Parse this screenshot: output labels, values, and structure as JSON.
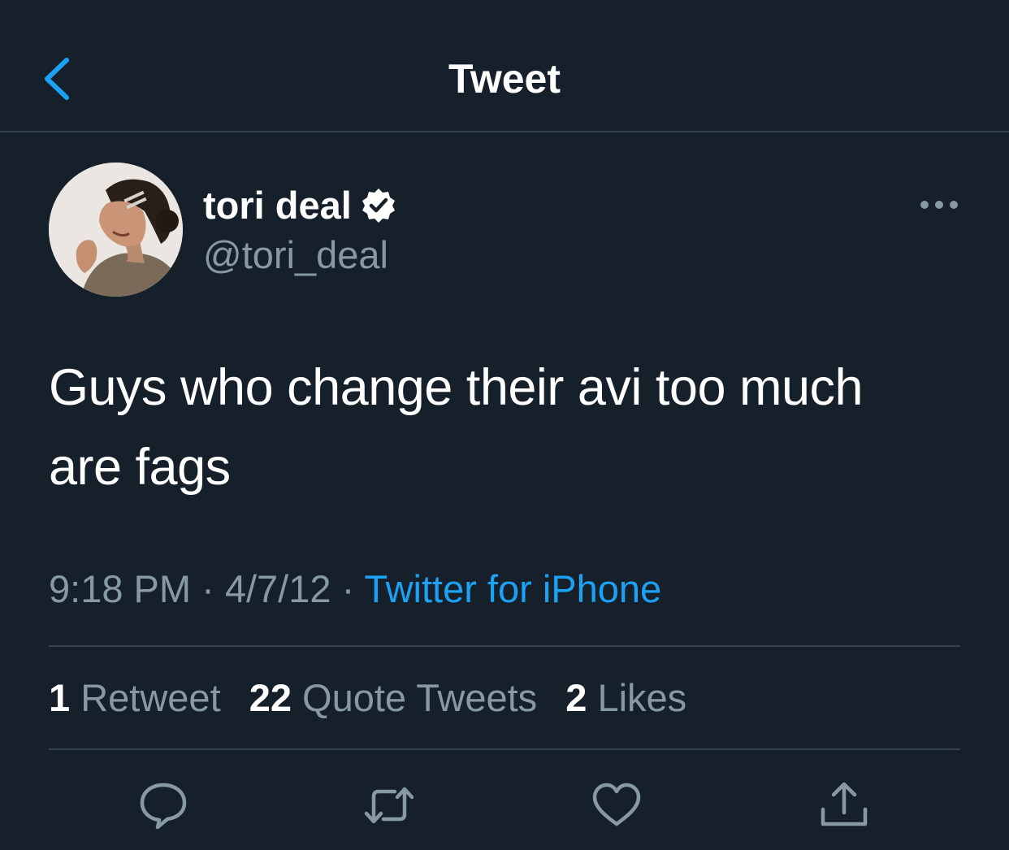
{
  "header": {
    "title": "Tweet",
    "back_icon": "chevron-left-icon"
  },
  "author": {
    "display_name": "tori deal",
    "handle": "@tori_deal",
    "verified": true
  },
  "tweet": {
    "text_line1": "Guys who change their avi too much",
    "text_line2": "are fags",
    "time": "9:18 PM",
    "separator": "·",
    "date": "4/7/12",
    "source": "Twitter for iPhone"
  },
  "stats": {
    "retweets_count": "1",
    "retweets_label": "Retweet",
    "quotes_count": "22",
    "quotes_label": "Quote Tweets",
    "likes_count": "2",
    "likes_label": "Likes"
  },
  "actions": [
    "reply-icon",
    "retweet-icon",
    "like-icon",
    "share-icon"
  ],
  "colors": {
    "background": "#15202b",
    "accent": "#1da1f2",
    "secondary_text": "#8899a6",
    "divider": "#38444d"
  }
}
